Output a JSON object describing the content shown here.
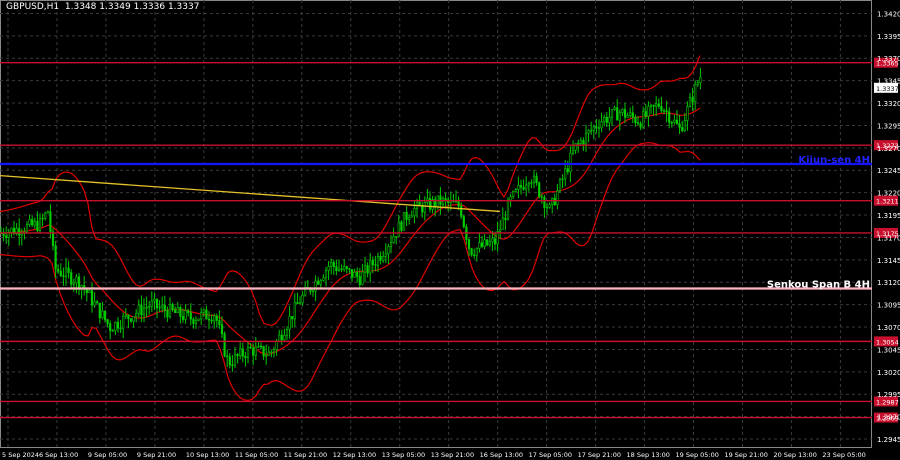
{
  "chart_data": {
    "type": "candlestick",
    "header": "GBPUSD,H1  1.3348 1.3349 1.3336 1.3337",
    "ylim": [
      1.2935,
      1.3435
    ],
    "y_ticks": [
      "1.3420",
      "1.3395",
      "1.3370",
      "1.3345",
      "1.3320",
      "1.3295",
      "1.3270",
      "1.3245",
      "1.3220",
      "1.3195",
      "1.3170",
      "1.3145",
      "1.3120",
      "1.3095",
      "1.3070",
      "1.3045",
      "1.3020",
      "1.2995",
      "1.2970",
      "1.2945"
    ],
    "y_tick_values": [
      1.342,
      1.3395,
      1.337,
      1.3345,
      1.332,
      1.3295,
      1.327,
      1.3245,
      1.322,
      1.3195,
      1.317,
      1.3145,
      1.312,
      1.3095,
      1.307,
      1.3045,
      1.302,
      1.2995,
      1.297,
      1.2945
    ],
    "x_ticks": [
      "5 Sep 2024",
      "6 Sep 13:00",
      "9 Sep 05:00",
      "9 Sep 21:00",
      "10 Sep 13:00",
      "11 Sep 05:00",
      "11 Sep 21:00",
      "12 Sep 13:00",
      "13 Sep 05:00",
      "13 Sep 21:00",
      "16 Sep 13:00",
      "17 Sep 05:00",
      "17 Sep 21:00",
      "18 Sep 13:00",
      "19 Sep 05:00",
      "19 Sep 21:00",
      "20 Sep 13:00",
      "23 Sep 05:00"
    ],
    "current_price": "1.3337",
    "current_price_value": 1.3337,
    "levels": [
      {
        "label": "1.3365",
        "value": 1.3365,
        "color": "#c8102e"
      },
      {
        "label": "1.3273",
        "value": 1.3273,
        "color": "#c8102e"
      },
      {
        "label": "1.3211",
        "value": 1.3211,
        "color": "#c8102e"
      },
      {
        "label": "1.3175",
        "value": 1.3175,
        "color": "#c8102e"
      },
      {
        "label": "1.3054",
        "value": 1.3054,
        "color": "#c8102e"
      },
      {
        "label": "1.2987",
        "value": 1.2987,
        "color": "#c8102e"
      },
      {
        "label": "1.2969",
        "value": 1.2969,
        "color": "#c8102e"
      }
    ],
    "named_lines": [
      {
        "label": "Kijun-sen 4H",
        "value": 1.3252,
        "color": "#1414ff",
        "text_color": "#2222ff"
      },
      {
        "label": "Senkou Span B 4H",
        "value": 1.3113,
        "color": "#ffb6c1",
        "text_color": "#ffffff"
      }
    ],
    "trend_line": {
      "from": 1.3239,
      "to": 1.3199,
      "color": "#e6c229"
    },
    "colors": {
      "background": "#000000",
      "grid": "#3a3a3a",
      "candle_up": "#00cc00",
      "candle_down": "#00cc00",
      "bollinger": "#e00000",
      "axis_text": "#ffffff"
    },
    "grid": true
  }
}
